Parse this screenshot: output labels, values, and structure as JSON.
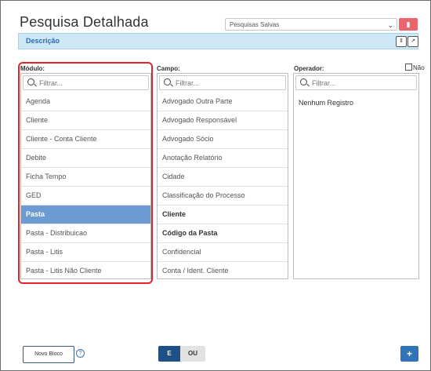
{
  "page_title": "Pesquisa Detalhada",
  "saved_searches": {
    "value": "Pesquisas Salvas",
    "delete_icon": "trash-icon"
  },
  "description_bar": {
    "label": "Descrição",
    "sort_icon": "sort-icon",
    "edit_icon": "edit-icon"
  },
  "modulo": {
    "label": "Módulo:",
    "filter_placeholder": "Filtrar...",
    "items": [
      "Agenda",
      "Cliente",
      "Cliente - Conta Cliente",
      "Debite",
      "Ficha Tempo",
      "GED",
      "Pasta",
      "Pasta - Distribuicao",
      "Pasta - Litis",
      "Pasta - Litis Não Cliente"
    ],
    "selected": "Pasta"
  },
  "campo": {
    "label": "Campo:",
    "filter_placeholder": "Filtrar...",
    "items": [
      "Advogado Outra Parte",
      "Advogado Responsável",
      "Advogado Sócio",
      "Anotação Relatório",
      "Cidade",
      "Classificação do Processo",
      "Cliente",
      "Código da Pasta",
      "Confidencial",
      "Conta / Ident. Cliente"
    ]
  },
  "operador": {
    "label": "Operador:",
    "filter_placeholder": "Filtrar...",
    "empty_text": "Nenhum Registro",
    "nao_label": "Não"
  },
  "footer": {
    "novo_bloco": "Novo Bloco",
    "help": "?",
    "e_label": "E",
    "ou_label": "OU",
    "add_label": "+"
  },
  "colors": {
    "selected_row": "#6b9bd0",
    "highlight_border": "#e0262b",
    "accent": "#2f73b8",
    "delete": "#e8666c"
  }
}
